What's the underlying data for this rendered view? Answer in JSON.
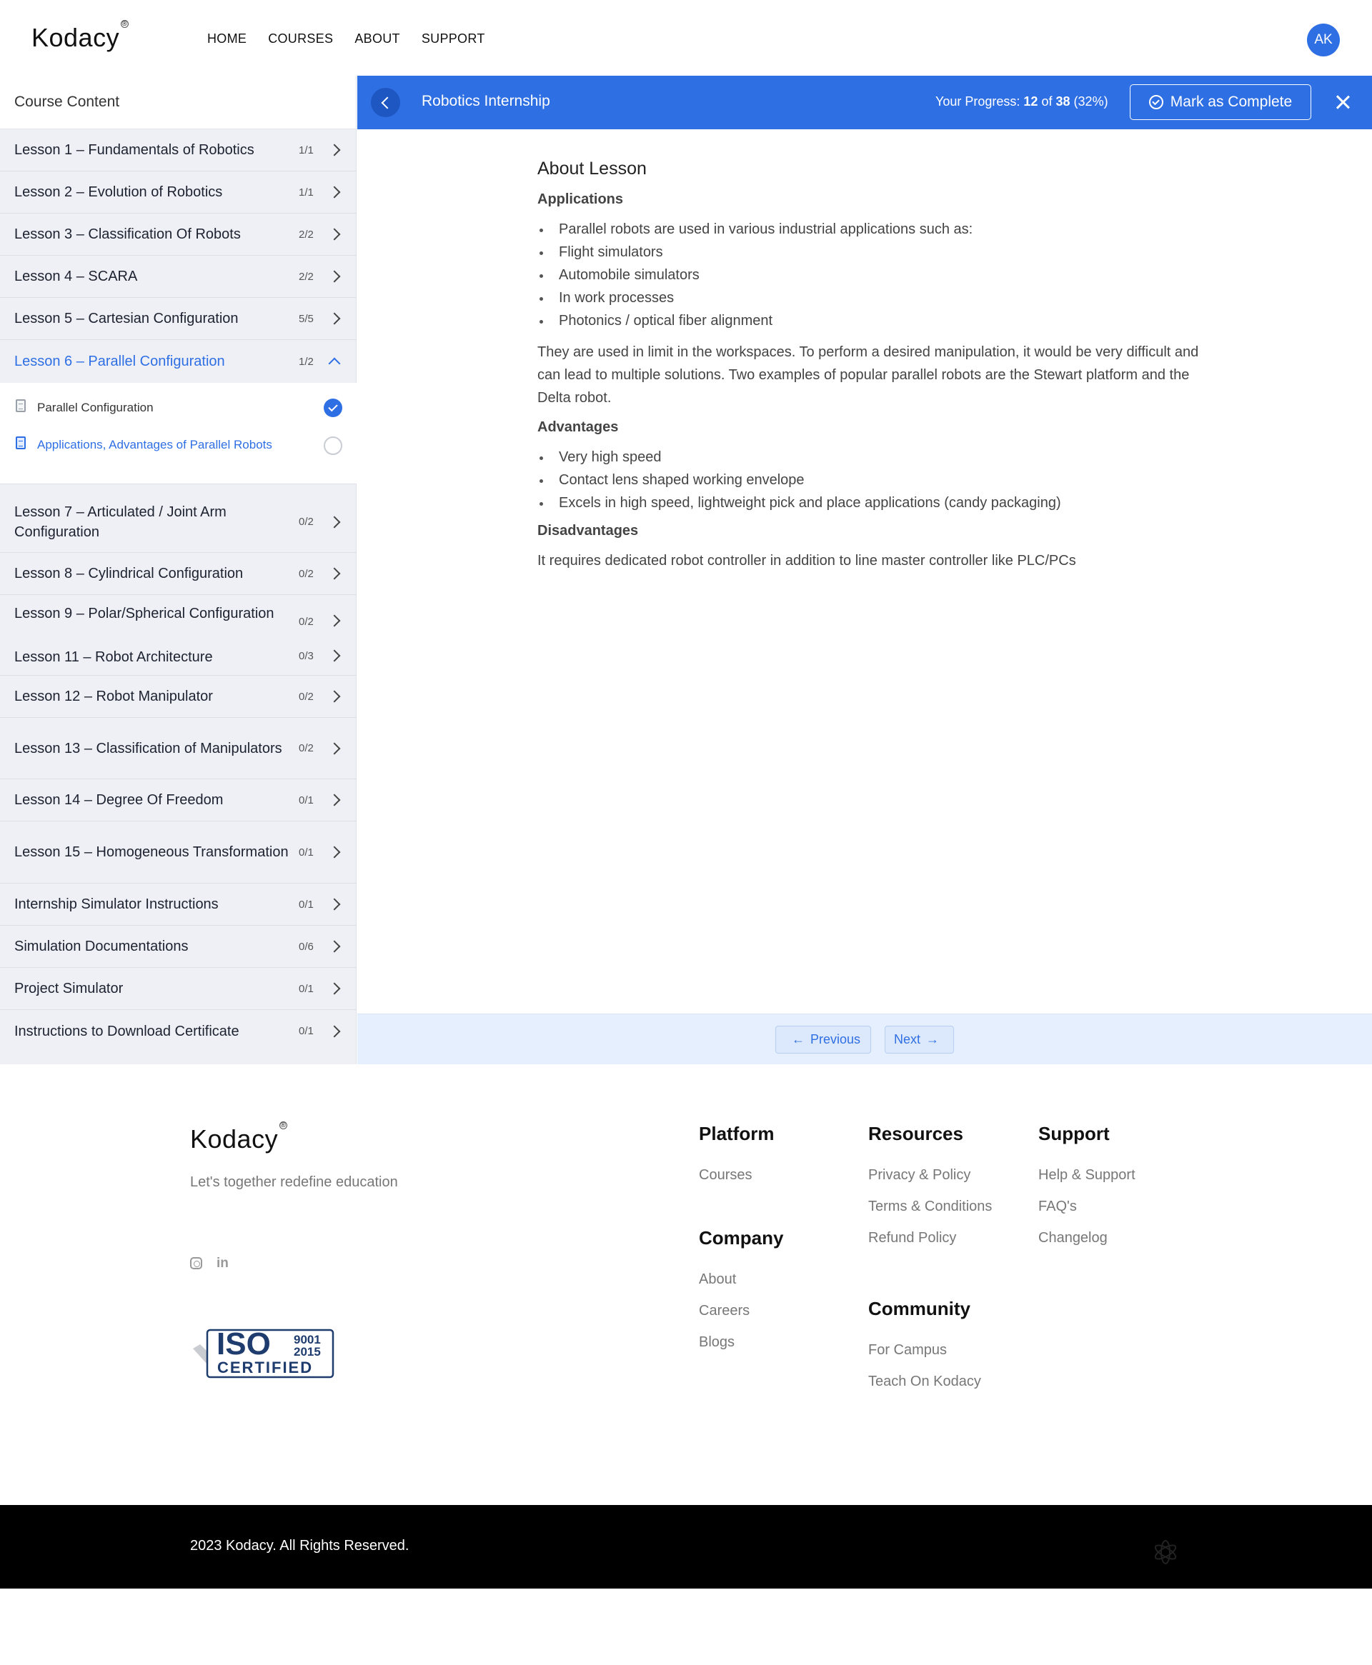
{
  "brand": {
    "name": "Kodacy",
    "mark": "®"
  },
  "nav": {
    "links": [
      "HOME",
      "COURSES",
      "ABOUT",
      "SUPPORT"
    ],
    "avatar_initials": "AK"
  },
  "sidebar": {
    "title": "Course Content",
    "lessons": [
      {
        "title": "Lesson 1 – Fundamentals of Robotics",
        "count": "1/1"
      },
      {
        "title": "Lesson 2 – Evolution of Robotics",
        "count": "1/1"
      },
      {
        "title": "Lesson 3 – Classification Of Robots",
        "count": "2/2"
      },
      {
        "title": "Lesson 4 – SCARA",
        "count": "2/2"
      },
      {
        "title": "Lesson 5 – Cartesian Configuration",
        "count": "5/5"
      },
      {
        "title": "Lesson 6 – Parallel Configuration",
        "count": "1/2",
        "expanded": true
      },
      {
        "title": "Lesson 7 – Articulated / Joint Arm Configuration",
        "count": "0/2"
      },
      {
        "title": "Lesson 8 – Cylindrical Configuration",
        "count": "0/2"
      },
      {
        "title": "Lesson 9 – Polar/Spherical Configuration",
        "count": "0/2"
      },
      {
        "title": "Lesson 11 – Robot Architecture",
        "count": "0/3"
      },
      {
        "title": "Lesson 12 – Robot Manipulator",
        "count": "0/2"
      },
      {
        "title": "Lesson 13 – Classification of Manipulators",
        "count": "0/2"
      },
      {
        "title": "Lesson 14 – Degree Of Freedom",
        "count": "0/1"
      },
      {
        "title": "Lesson 15 – Homogeneous Transformation",
        "count": "0/1"
      },
      {
        "title": "Internship Simulator Instructions",
        "count": "0/1"
      },
      {
        "title": "Simulation Documentations",
        "count": "0/6"
      },
      {
        "title": "Project Simulator",
        "count": "0/1"
      },
      {
        "title": "Instructions to Download Certificate",
        "count": "0/1"
      }
    ],
    "sub_items": [
      {
        "title": "Parallel Configuration",
        "done": true
      },
      {
        "title": "Applications, Advantages of Parallel Robots",
        "done": false,
        "current": true
      }
    ]
  },
  "course_bar": {
    "title": "Robotics Internship",
    "progress_label": "Your Progress:",
    "progress_done": "12",
    "progress_of": "of",
    "progress_total": "38",
    "progress_pct": "(32%)",
    "progress_fraction": 0.32,
    "mark_complete": "Mark as Complete"
  },
  "lesson": {
    "heading": "About Lesson",
    "applications_heading": "Applications",
    "applications": [
      "Parallel robots are used in various industrial applications such as:",
      "Flight simulators",
      "Automobile simulators",
      "In work processes",
      "Photonics / optical fiber alignment"
    ],
    "paragraph": "They are used in limit in the workspaces. To perform a desired manipulation, it would be very difficult and can lead to multiple solutions. Two examples of popular parallel robots are the Stewart platform and the Delta robot.",
    "advantages_heading": "Advantages",
    "advantages": [
      "Very high speed",
      "Contact lens shaped working envelope",
      "Excels in high speed, lightweight pick and place applications (candy packaging)"
    ],
    "disadvantages_heading": "Disadvantages",
    "disadvantages_text": "It requires dedicated robot controller in addition to line master controller like PLC/PCs"
  },
  "pager": {
    "previous": "Previous",
    "next": "Next"
  },
  "footer": {
    "tagline": "Let's together redefine education",
    "iso": {
      "big": "ISO",
      "num1": "9001",
      "num2": "2015",
      "certified": "CERTIFIED"
    },
    "platform": {
      "heading": "Platform",
      "links": [
        "Courses"
      ]
    },
    "company": {
      "heading": "Company",
      "links": [
        "About",
        "Careers",
        "Blogs"
      ]
    },
    "resources": {
      "heading": "Resources",
      "links": [
        "Privacy & Policy",
        "Terms & Conditions",
        "Refund Policy"
      ]
    },
    "community": {
      "heading": "Community",
      "links": [
        "For Campus",
        "Teach On Kodacy"
      ]
    },
    "support": {
      "heading": "Support",
      "links": [
        "Help & Support",
        "FAQ's",
        "Changelog"
      ]
    },
    "copyright": "2023 Kodacy. All Rights Reserved."
  },
  "icons": [
    "back-chevron-icon",
    "check-circle-icon",
    "close-icon",
    "chevron-right-icon",
    "chevron-up-icon",
    "document-icon",
    "instagram-icon",
    "linkedin-icon",
    "arrow-left-icon",
    "arrow-right-icon"
  ],
  "colors": {
    "accent": "#2f6fe4",
    "sidebar_bg": "#eef0f5",
    "pager_bg": "#e6effd",
    "footer_bar": "#000000"
  }
}
